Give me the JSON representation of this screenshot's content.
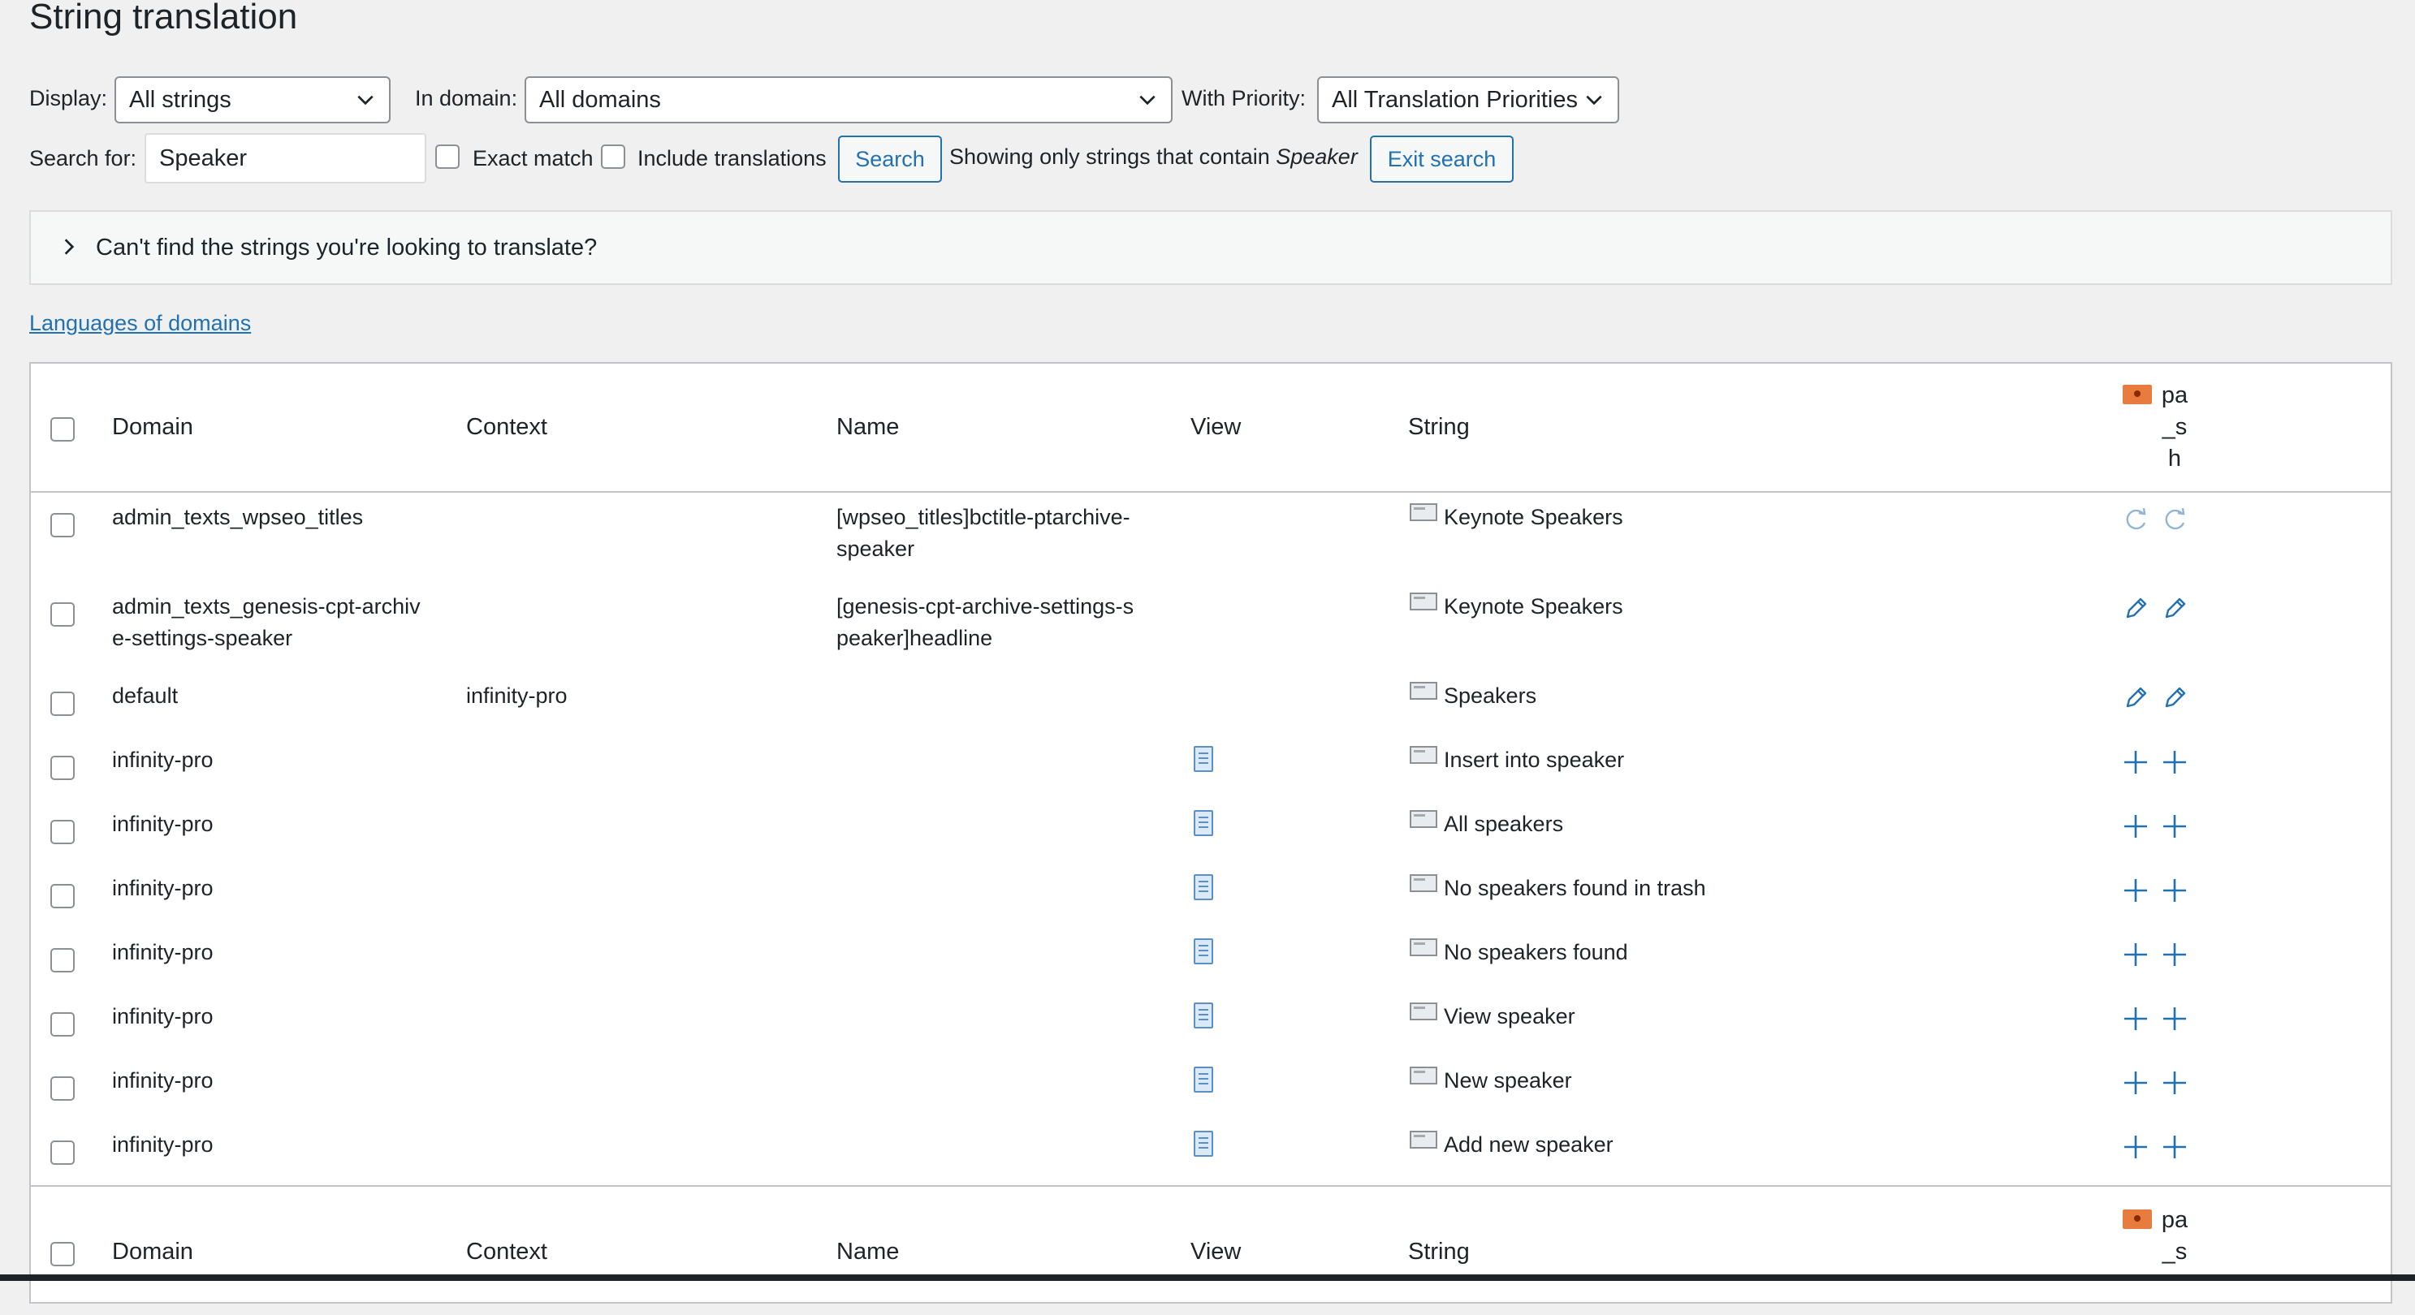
{
  "page": {
    "title": "String translation"
  },
  "filters": {
    "display_label": "Display:",
    "display_value": "All strings",
    "domain_label": "In domain:",
    "domain_value": "All domains",
    "priority_label": "With Priority:",
    "priority_value": "All Translation Priorities"
  },
  "search": {
    "label": "Search for:",
    "value": "Speaker",
    "exact_match_label": "Exact match",
    "include_translations_label": "Include translations",
    "search_button": "Search",
    "notice_prefix": "Showing only strings that contain",
    "notice_term": "Speaker",
    "exit_button": "Exit search"
  },
  "disclosure": {
    "text": "Can't find the strings you're looking to translate?"
  },
  "languages_link": "Languages of domains",
  "table": {
    "headers": {
      "domain": "Domain",
      "context": "Context",
      "name": "Name",
      "view": "View",
      "string": "String"
    },
    "language_code": [
      "pa",
      "_s",
      "h"
    ],
    "rows": [
      {
        "domain": [
          "admin_texts_wpseo_titles"
        ],
        "context": "",
        "name": [
          "[wpseo_titles]bctitle-ptarchive-",
          "speaker"
        ],
        "view": false,
        "string": "Keynote Speakers",
        "action": "sync"
      },
      {
        "domain": [
          "admin_texts_genesis-cpt-archiv",
          "e-settings-speaker"
        ],
        "context": "",
        "name": [
          "[genesis-cpt-archive-settings-s",
          "peaker]headline"
        ],
        "view": false,
        "string": "Keynote Speakers",
        "action": "edit"
      },
      {
        "domain": [
          "default"
        ],
        "context": "infinity-pro",
        "name": [],
        "view": false,
        "string": "Speakers",
        "action": "edit"
      },
      {
        "domain": [
          "infinity-pro"
        ],
        "context": "",
        "name": [],
        "view": true,
        "string": "Insert into speaker",
        "action": "add"
      },
      {
        "domain": [
          "infinity-pro"
        ],
        "context": "",
        "name": [],
        "view": true,
        "string": "All speakers",
        "action": "add"
      },
      {
        "domain": [
          "infinity-pro"
        ],
        "context": "",
        "name": [],
        "view": true,
        "string": "No speakers found in trash",
        "action": "add"
      },
      {
        "domain": [
          "infinity-pro"
        ],
        "context": "",
        "name": [],
        "view": true,
        "string": "No speakers found",
        "action": "add"
      },
      {
        "domain": [
          "infinity-pro"
        ],
        "context": "",
        "name": [],
        "view": true,
        "string": "View speaker",
        "action": "add"
      },
      {
        "domain": [
          "infinity-pro"
        ],
        "context": "",
        "name": [],
        "view": true,
        "string": "New speaker",
        "action": "add"
      },
      {
        "domain": [
          "infinity-pro"
        ],
        "context": "",
        "name": [],
        "view": true,
        "string": "Add new speaker",
        "action": "add"
      }
    ]
  },
  "icons": {
    "chevron": "chevron-down-icon",
    "caret": "chevron-right-icon",
    "string_type": "string-type-icon",
    "view": "document-icon",
    "sync": "sync-icon",
    "edit": "pencil-icon",
    "add": "plus-icon",
    "flag": "language-flag-icon"
  },
  "colors": {
    "accent": "#2271b1",
    "flag": "#e87b3e",
    "background": "#f0f0f1"
  }
}
